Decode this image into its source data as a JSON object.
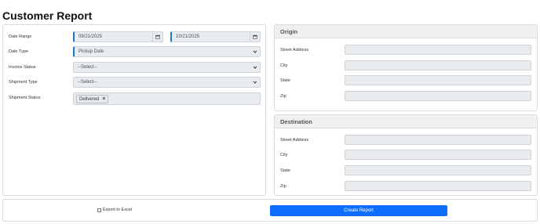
{
  "page": {
    "title": "Customer Report"
  },
  "filters": {
    "date_range": {
      "label": "Date Range",
      "start": "09/21/2025",
      "end": "10/21/2025",
      "icon": "calendar-icon"
    },
    "date_type": {
      "label": "Date Type",
      "value": "Pickup Date"
    },
    "invoice_status": {
      "label": "Invoice Status",
      "value": "--Select--"
    },
    "shipment_type": {
      "label": "Shipment Type",
      "value": "--Select--"
    },
    "shipment_status": {
      "label": "Shipment Status",
      "tags": [
        "Delivered"
      ],
      "remove_glyph": "×"
    }
  },
  "origin": {
    "title": "Origin",
    "fields": {
      "street": "Street Address",
      "city": "City",
      "state": "State",
      "zip": "Zip"
    }
  },
  "destination": {
    "title": "Destination",
    "fields": {
      "street": "Street Address",
      "city": "City",
      "state": "State",
      "zip": "Zip"
    }
  },
  "footer": {
    "export_label": "Export to Excel",
    "export_checked": false,
    "create_label": "Create Report"
  },
  "colors": {
    "accent": "#1976d2",
    "primary_button": "#0d6efd",
    "input_bg": "#e9ecef"
  }
}
